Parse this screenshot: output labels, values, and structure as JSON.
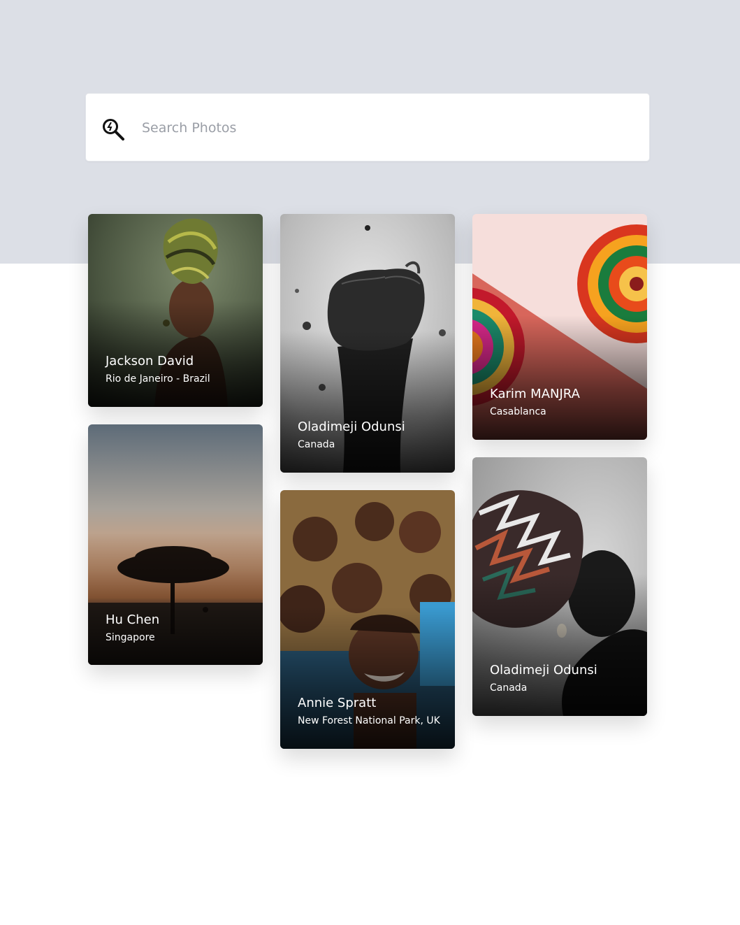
{
  "search": {
    "placeholder": "Search Photos",
    "value": ""
  },
  "photos": [
    {
      "name": "Jackson David",
      "location": "Rio de Janeiro - Brazil"
    },
    {
      "name": "Oladimeji Odunsi",
      "location": "Canada"
    },
    {
      "name": "Karim MANJRA",
      "location": "Casablanca"
    },
    {
      "name": "Hu Chen",
      "location": "Singapore"
    },
    {
      "name": "Annie Spratt",
      "location": "New Forest National Park, UK"
    },
    {
      "name": "Oladimeji Odunsi",
      "location": "Canada"
    }
  ],
  "icons": {
    "search": "search-icon"
  },
  "colors": {
    "background_band": "#dcdfe6",
    "placeholder": "#9a9ea6",
    "card_text": "#ffffff"
  }
}
